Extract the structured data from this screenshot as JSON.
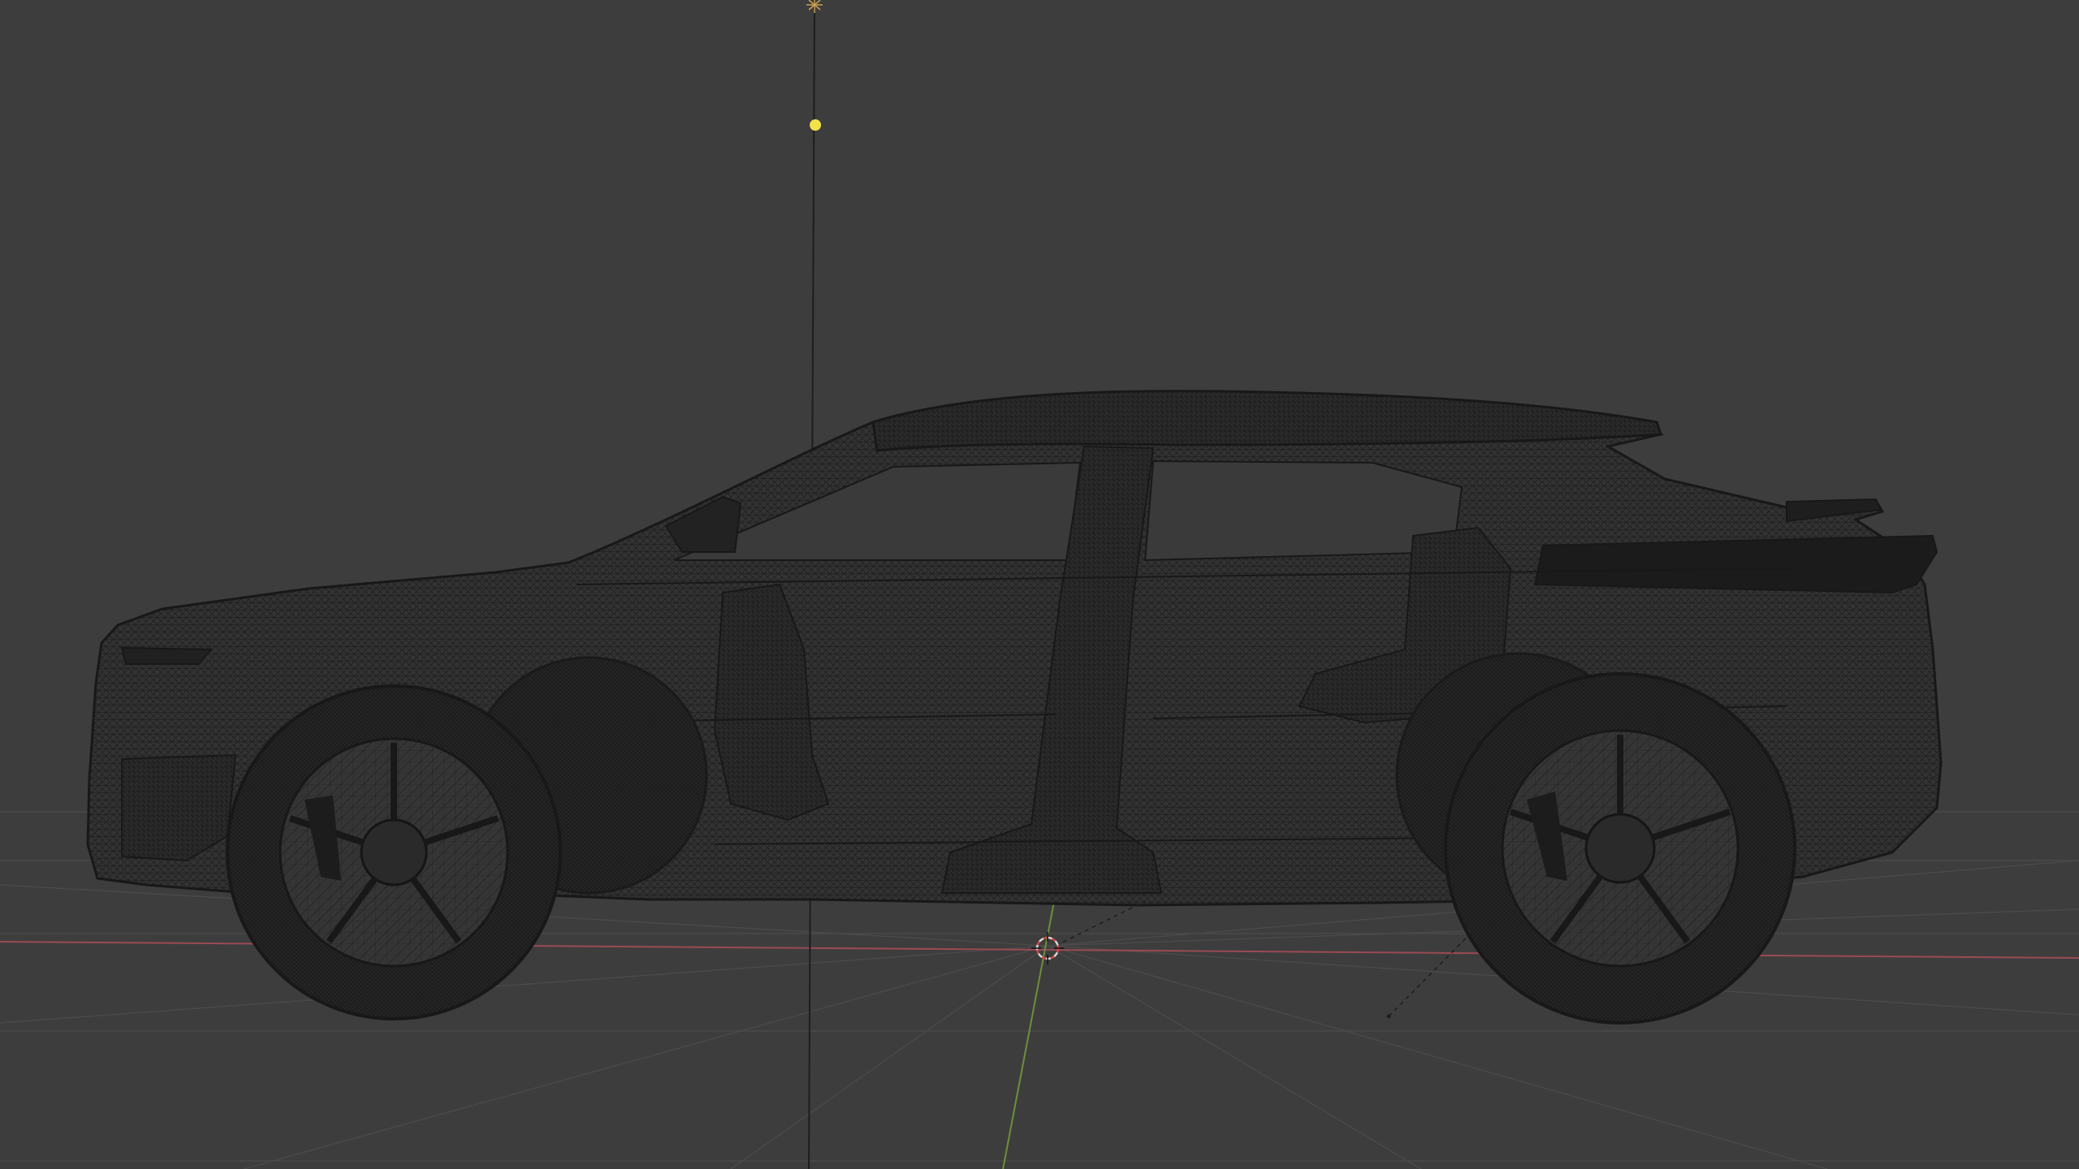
{
  "app": {
    "name": "3D Viewport",
    "shading_mode": "wireframe",
    "view": "side-orthographic"
  },
  "scene": {
    "objects": [
      {
        "name": "car-body",
        "type": "mesh",
        "display": "wireframe"
      },
      {
        "name": "light",
        "type": "light"
      },
      {
        "name": "3d-cursor",
        "type": "cursor"
      }
    ]
  },
  "colors": {
    "background": "#3d3d3d",
    "grid": "#4a4a4a",
    "x_axis": "#9a4a55",
    "y_axis": "#6c8f3c",
    "wire": "#1c1c1c",
    "light_dot": "#f2e24a",
    "cursor_ring": "#d9d9d9",
    "cursor_accent": "#d04848"
  },
  "icons": {
    "light": "light-bulb-icon",
    "origin": "origin-dot-icon",
    "cursor": "3d-cursor-icon"
  }
}
